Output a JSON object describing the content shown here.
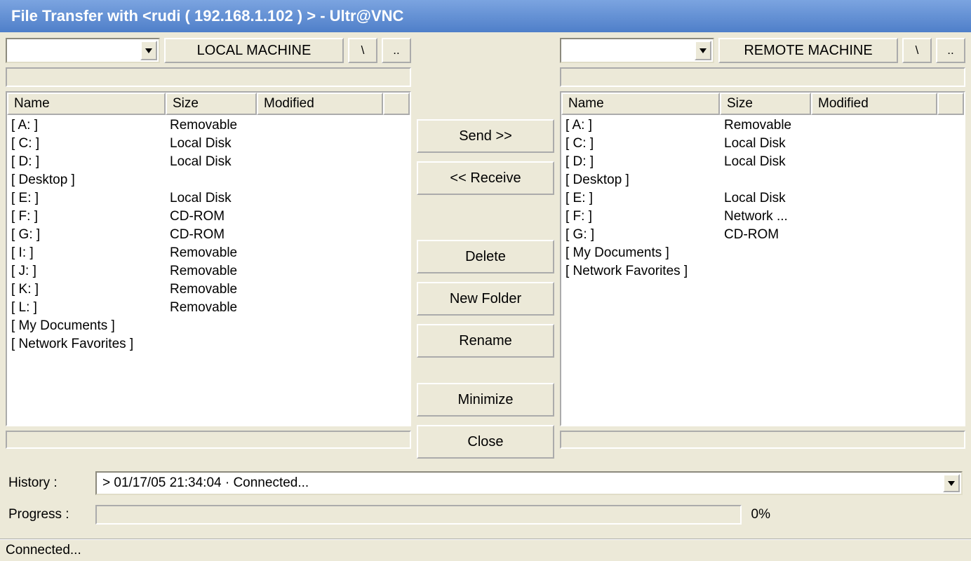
{
  "window": {
    "title": "File Transfer with <rudi ( 192.168.1.102 ) >   -   Ultr@VNC"
  },
  "local": {
    "machine_label": "LOCAL MACHINE",
    "root_btn": "\\",
    "up_btn": "..",
    "columns": {
      "name": "Name",
      "size": "Size",
      "modified": "Modified"
    },
    "items": [
      {
        "name": "[ A: ]",
        "size": "Removable",
        "modified": ""
      },
      {
        "name": "[ C: ]",
        "size": "Local Disk",
        "modified": ""
      },
      {
        "name": "[ D: ]",
        "size": "Local Disk",
        "modified": ""
      },
      {
        "name": "[ Desktop ]",
        "size": "",
        "modified": ""
      },
      {
        "name": "[ E: ]",
        "size": "Local Disk",
        "modified": ""
      },
      {
        "name": "[ F: ]",
        "size": "CD-ROM",
        "modified": ""
      },
      {
        "name": "[ G: ]",
        "size": "CD-ROM",
        "modified": ""
      },
      {
        "name": "[ I: ]",
        "size": "Removable",
        "modified": ""
      },
      {
        "name": "[ J: ]",
        "size": "Removable",
        "modified": ""
      },
      {
        "name": "[ K: ]",
        "size": "Removable",
        "modified": ""
      },
      {
        "name": "[ L: ]",
        "size": "Removable",
        "modified": ""
      },
      {
        "name": "[ My Documents ]",
        "size": "",
        "modified": ""
      },
      {
        "name": "[ Network Favorites ]",
        "size": "",
        "modified": ""
      }
    ]
  },
  "remote": {
    "machine_label": "REMOTE MACHINE",
    "root_btn": "\\",
    "up_btn": "..",
    "columns": {
      "name": "Name",
      "size": "Size",
      "modified": "Modified"
    },
    "items": [
      {
        "name": "[ A: ]",
        "size": "Removable",
        "modified": ""
      },
      {
        "name": "[ C: ]",
        "size": "Local Disk",
        "modified": ""
      },
      {
        "name": "[ D: ]",
        "size": "Local Disk",
        "modified": ""
      },
      {
        "name": "[ Desktop ]",
        "size": "",
        "modified": ""
      },
      {
        "name": "[ E: ]",
        "size": "Local Disk",
        "modified": ""
      },
      {
        "name": "[ F: ]",
        "size": "Network ...",
        "modified": ""
      },
      {
        "name": "[ G: ]",
        "size": "CD-ROM",
        "modified": ""
      },
      {
        "name": "[ My Documents ]",
        "size": "",
        "modified": ""
      },
      {
        "name": "[ Network Favorites ]",
        "size": "",
        "modified": ""
      }
    ]
  },
  "actions": {
    "send": "Send >>",
    "receive": "<< Receive",
    "delete": "Delete",
    "new_folder": "New Folder",
    "rename": "Rename",
    "minimize": "Minimize",
    "close": "Close"
  },
  "history": {
    "label": "History :",
    "value": " > 01/17/05 21:34:04 · Connected..."
  },
  "progress": {
    "label": "Progress :",
    "percent": "0%"
  },
  "status": "Connected..."
}
